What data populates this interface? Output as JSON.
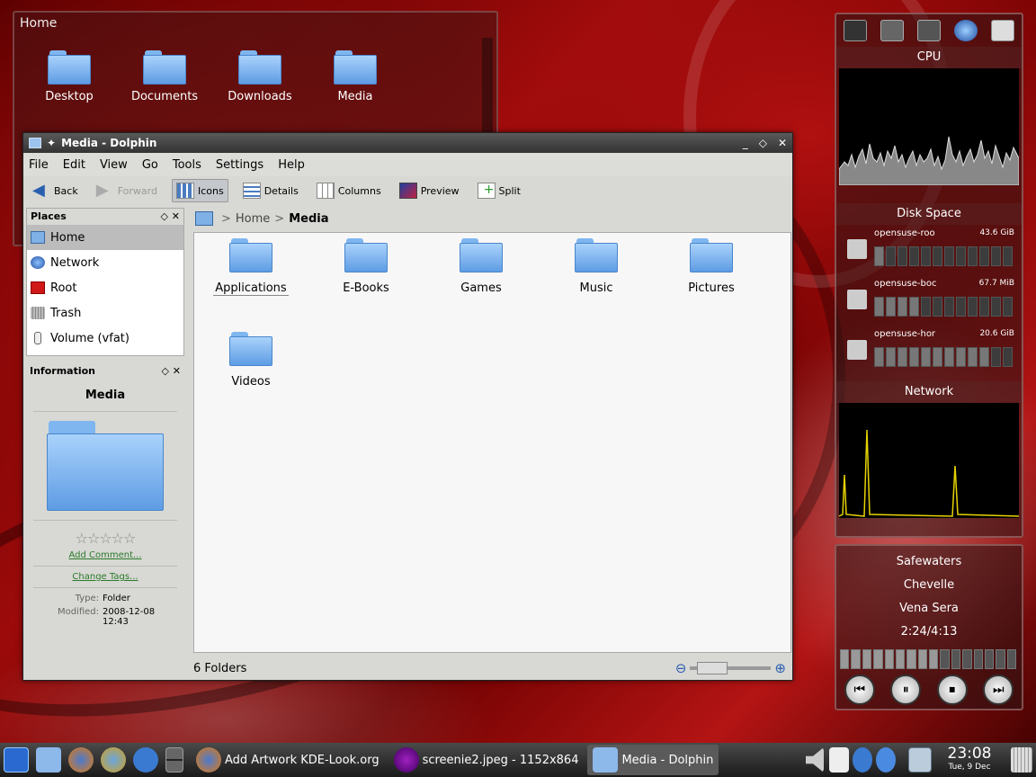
{
  "home_window": {
    "title": "Home",
    "icons": [
      "Desktop",
      "Documents",
      "Downloads",
      "Media"
    ]
  },
  "dolphin": {
    "title": "Media - Dolphin",
    "menu": [
      "File",
      "Edit",
      "View",
      "Go",
      "Tools",
      "Settings",
      "Help"
    ],
    "toolbar": {
      "back": "Back",
      "forward": "Forward",
      "icons": "Icons",
      "details": "Details",
      "columns": "Columns",
      "preview": "Preview",
      "split": "Split"
    },
    "places": {
      "title": "Places",
      "items": [
        "Home",
        "Network",
        "Root",
        "Trash",
        "Volume (vfat)"
      ]
    },
    "information": {
      "title": "Information",
      "name": "Media",
      "stars": "☆☆☆☆☆",
      "add_comment": "Add Comment...",
      "change_tags": "Change Tags...",
      "type_label": "Type:",
      "type_value": "Folder",
      "modified_label": "Modified:",
      "modified_value": "2008-12-08 12:43"
    },
    "breadcrumb": [
      "Home",
      "Media"
    ],
    "folders": [
      "Applications",
      "E-Books",
      "Games",
      "Music",
      "Pictures",
      "Videos"
    ],
    "status": "6 Folders"
  },
  "monitor": {
    "cpu_title": "CPU",
    "disk_title": "Disk Space",
    "disks": [
      {
        "name": "opensuse-roo",
        "size": "43.6 GiB",
        "used": 0.1
      },
      {
        "name": "opensuse-boc",
        "size": "67.7 MiB",
        "used": 0.35
      },
      {
        "name": "opensuse-hor",
        "size": "20.6 GiB",
        "used": 0.8
      }
    ],
    "network_title": "Network"
  },
  "player": {
    "song": "Safewaters",
    "artist": "Chevelle",
    "album": "Vena Sera",
    "time": "2:24/4:13",
    "progress": 0.57
  },
  "taskbar": {
    "tasks": [
      "Add Artwork KDE-Look.org",
      "screenie2.jpeg - 1152x864",
      "Media - Dolphin"
    ],
    "time": "23:08",
    "date": "Tue, 9 Dec"
  }
}
